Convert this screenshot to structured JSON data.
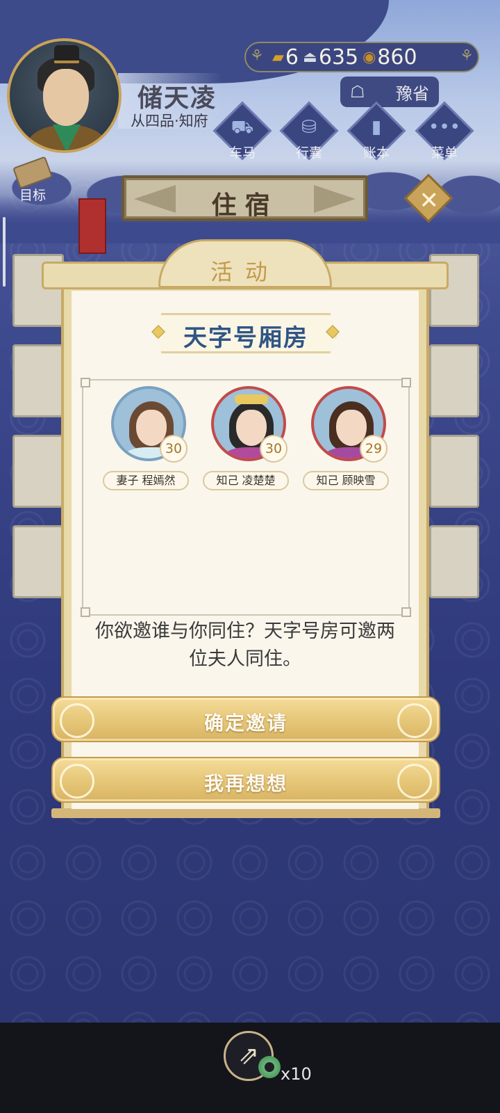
{
  "header": {
    "player_name": "储天凌",
    "player_rank": "从四品·知府",
    "currency": {
      "gold": "6",
      "silver": "635",
      "coins": "860"
    },
    "location": "豫省"
  },
  "menu": [
    {
      "label": "车马",
      "icon": "carriage-icon"
    },
    {
      "label": "行囊",
      "icon": "bag-icon"
    },
    {
      "label": "账本",
      "icon": "ledger-icon"
    },
    {
      "label": "菜单",
      "icon": "more-icon"
    }
  ],
  "goal_label": "目标",
  "page_title": "住宿",
  "modal": {
    "title": "活动",
    "room_name": "天字号厢房",
    "guests": [
      {
        "relation": "妻子",
        "name": "程嫣然",
        "level": "30",
        "tag": "妻子 程嫣然"
      },
      {
        "relation": "知己",
        "name": "凌楚楚",
        "level": "30",
        "tag": "知己 凌楚楚"
      },
      {
        "relation": "知己",
        "name": "顾映雪",
        "level": "29",
        "tag": "知己 顾映雪"
      }
    ],
    "prompt": "你欲邀谁与你同住？天字号房可邀两位夫人同住。",
    "confirm_label": "确定邀请",
    "cancel_label": "我再想想"
  },
  "share": {
    "count": "x10"
  },
  "colors": {
    "accent_gold": "#c9a35a",
    "room_name_blue": "#2f5585",
    "button_gold": "#e7c87a"
  }
}
